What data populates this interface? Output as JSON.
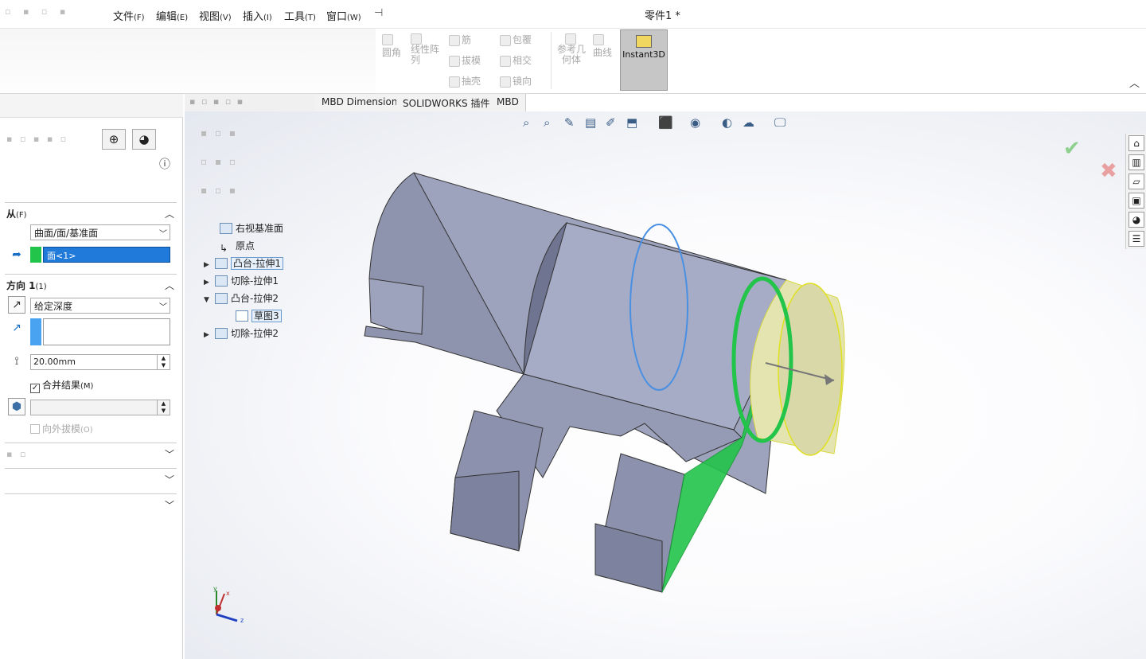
{
  "menubar": {
    "items": [
      {
        "label": "文件",
        "key": "(F)"
      },
      {
        "label": "编辑",
        "key": "(E)"
      },
      {
        "label": "视图",
        "key": "(V)"
      },
      {
        "label": "插入",
        "key": "(I)"
      },
      {
        "label": "工具",
        "key": "(T)"
      },
      {
        "label": "窗口",
        "key": "(W)"
      }
    ],
    "document_title": "零件1 *"
  },
  "ribbon": {
    "fillet": "圆角",
    "linear_pattern": "线性阵列",
    "rib": "筋",
    "draft": "拔模",
    "shell": "抽壳",
    "wrap": "包覆",
    "intersect": "相交",
    "mirror": "镜向",
    "reference_geometry": "参考几何体",
    "curves": "曲线",
    "instant3d": "Instant3D"
  },
  "tabs": [
    "MBD Dimensions",
    "SOLIDWORKS 插件",
    "MBD"
  ],
  "property_manager": {
    "from": {
      "title": "从",
      "key": "(F)",
      "type_value": "曲面/面/基准面",
      "selection": "面<1>"
    },
    "direction1": {
      "title": "方向 1",
      "key": "(1)",
      "end_condition": "给定深度",
      "depth": "20.00mm",
      "merge_result": "合并结果",
      "merge_key": "(M)",
      "draft_outward": "向外拔模",
      "draft_key": "(O)"
    }
  },
  "feature_tree": [
    {
      "label": "右视基准面",
      "expand": ""
    },
    {
      "label": "原点",
      "expand": ""
    },
    {
      "label": "凸台-拉伸1",
      "expand": "▶"
    },
    {
      "label": "切除-拉伸1",
      "expand": "▶"
    },
    {
      "label": "凸台-拉伸2",
      "expand": "▼"
    },
    {
      "label": "草图3",
      "expand": ""
    },
    {
      "label": "切除-拉伸2",
      "expand": "▶"
    }
  ],
  "triad": {
    "x": "x",
    "y": "y",
    "z": "z"
  },
  "colors": {
    "selection_green": "#22c44a",
    "highlight_blue": "#1f7ad9",
    "instant3d_bg": "#c6c6c6"
  }
}
